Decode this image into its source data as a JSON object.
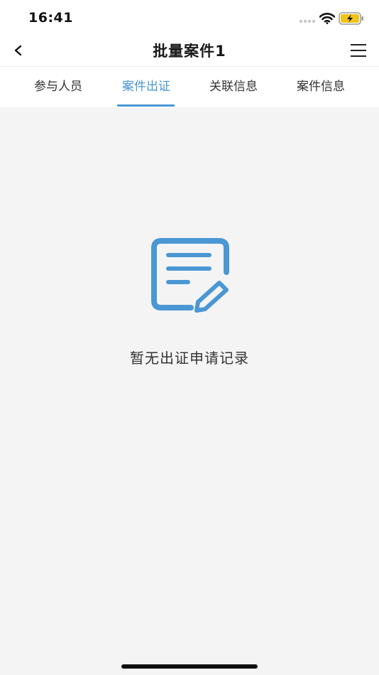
{
  "status_bar": {
    "time": "16:41"
  },
  "nav": {
    "title": "批量案件1",
    "back_icon": "chevron-left-icon",
    "menu_icon": "hamburger-menu-icon"
  },
  "tabs": [
    {
      "label": "参与人员",
      "active": false
    },
    {
      "label": "案件出证",
      "active": true
    },
    {
      "label": "关联信息",
      "active": false
    },
    {
      "label": "案件信息",
      "active": false
    }
  ],
  "empty_state": {
    "icon": "edit-document-icon",
    "message": "暂无出证申请记录"
  },
  "colors": {
    "accent": "#4a97d4",
    "icon": "#4a97d4",
    "background": "#f4f4f5",
    "battery": "#f0c419"
  }
}
